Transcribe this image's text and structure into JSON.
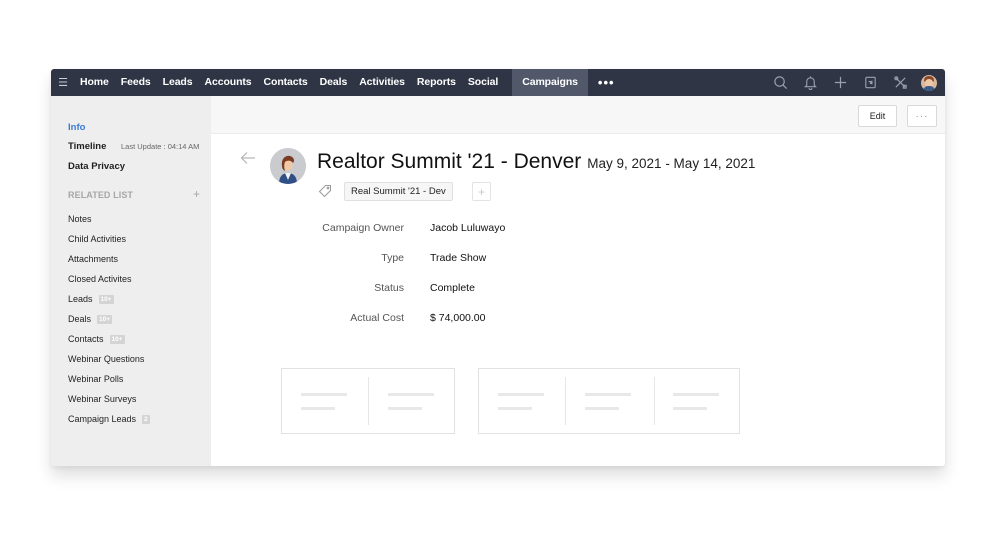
{
  "nav": {
    "menu_icon": "hamburger-icon",
    "items": [
      {
        "label": "Home"
      },
      {
        "label": "Feeds"
      },
      {
        "label": "Leads"
      },
      {
        "label": "Accounts"
      },
      {
        "label": "Contacts"
      },
      {
        "label": "Deals"
      },
      {
        "label": "Activities"
      },
      {
        "label": "Reports"
      },
      {
        "label": "Social"
      }
    ],
    "active_item": "Campaigns",
    "more_label": "•••",
    "right_icons": [
      "search-icon",
      "bell-icon",
      "plus-icon",
      "calendar-icon",
      "tools-icon",
      "user-avatar"
    ]
  },
  "sidebar": {
    "info": "Info",
    "timeline": "Timeline",
    "last_update": "Last Update : 04:14 AM",
    "data_privacy": "Data Privacy",
    "related_title": "RELATED LIST",
    "related_add": "+",
    "related": [
      {
        "label": "Notes",
        "badge": null
      },
      {
        "label": "Child Activities",
        "badge": null
      },
      {
        "label": "Attachments",
        "badge": null
      },
      {
        "label": "Closed Activites",
        "badge": null
      },
      {
        "label": "Leads",
        "badge": "10+"
      },
      {
        "label": "Deals",
        "badge": "10+"
      },
      {
        "label": "Contacts",
        "badge": "10+"
      },
      {
        "label": "Webinar Questions",
        "badge": null
      },
      {
        "label": "Webinar Polls",
        "badge": null
      },
      {
        "label": "Webinar Surveys",
        "badge": null
      },
      {
        "label": "Campaign Leads",
        "badge": "2"
      }
    ]
  },
  "toolbar": {
    "edit_label": "Edit",
    "more_label": "···"
  },
  "record": {
    "title": "Realtor Summit '21 - Denver",
    "dates": "May 9, 2021 - May 14, 2021",
    "tag": "Real Summit '21 - Dev",
    "tag_add": "+"
  },
  "fields": [
    {
      "label": "Campaign Owner",
      "value": "Jacob Luluwayo"
    },
    {
      "label": "Type",
      "value": "Trade Show"
    },
    {
      "label": "Status",
      "value": "Complete"
    },
    {
      "label": "Actual Cost",
      "value": "$ 74,000.00"
    }
  ],
  "colors": {
    "nav_bg": "#2f3545",
    "nav_active_bg": "#50586a",
    "sidebar_bg": "#eeeeee",
    "accent": "#3a7bd5"
  }
}
